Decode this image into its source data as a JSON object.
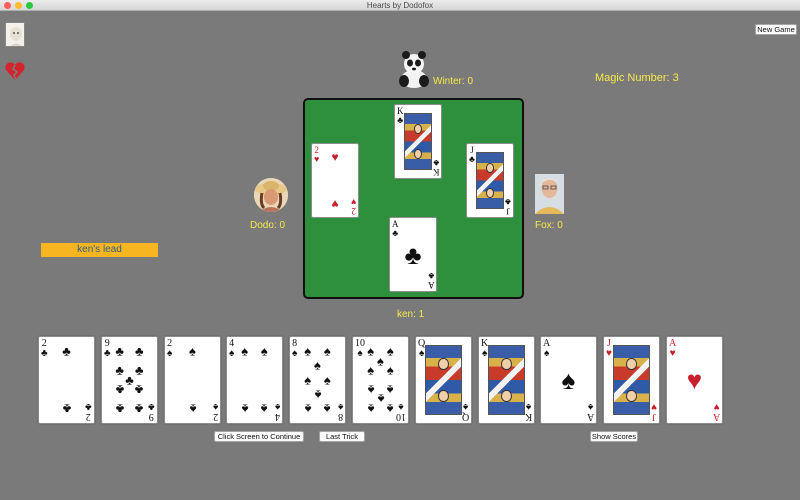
{
  "window": {
    "title": "Hearts by Dodofox"
  },
  "icons": {
    "user_avatar": "portrait-icon",
    "broken_heart": "broken-heart-icon"
  },
  "colors": {
    "table_felt": "#2e8f3d",
    "label_yellow": "#f7e84a",
    "banner": "#f6b521",
    "heart_red": "#c8202c"
  },
  "buttons": {
    "new_game": "New Game",
    "continue": "Click Screen to Continue",
    "last_trick": "Last Trick",
    "show_scores": "Show Scores"
  },
  "magic_number": "Magic Number:  3",
  "lead_banner": "ken's lead",
  "players": {
    "north": {
      "score_label": "Winter: 0",
      "avatar": "panda-icon"
    },
    "west": {
      "score_label": "Dodo: 0",
      "avatar": "woman-in-hat-icon"
    },
    "east": {
      "score_label": "Fox: 0",
      "avatar": "man-portrait-icon"
    },
    "south": {
      "score_label": "ken: 1"
    }
  },
  "trick": [
    {
      "seat": "north",
      "rank": "K",
      "suit": "♣",
      "face": true
    },
    {
      "seat": "west",
      "rank": "2",
      "suit": "♥",
      "face": false
    },
    {
      "seat": "east",
      "rank": "J",
      "suit": "♣",
      "face": true
    },
    {
      "seat": "south",
      "rank": "A",
      "suit": "♣",
      "face": false
    }
  ],
  "hand": [
    {
      "rank": "2",
      "suit": "♣"
    },
    {
      "rank": "9",
      "suit": "♣"
    },
    {
      "rank": "2",
      "suit": "♠"
    },
    {
      "rank": "4",
      "suit": "♠"
    },
    {
      "rank": "8",
      "suit": "♠"
    },
    {
      "rank": "10",
      "suit": "♠"
    },
    {
      "rank": "Q",
      "suit": "♠"
    },
    {
      "rank": "K",
      "suit": "♠"
    },
    {
      "rank": "A",
      "suit": "♠"
    },
    {
      "rank": "J",
      "suit": "♥"
    },
    {
      "rank": "A",
      "suit": "♥"
    }
  ]
}
